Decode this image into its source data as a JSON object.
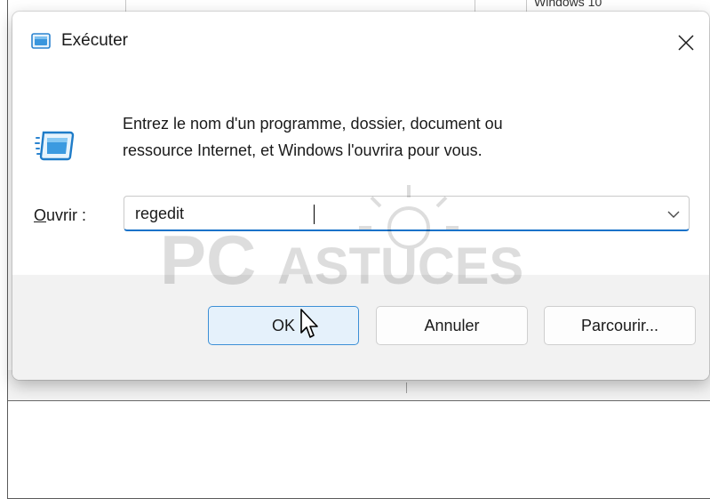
{
  "background": {
    "top_text": "Windows 10"
  },
  "dialog": {
    "title": "Exécuter",
    "title_icon": "run-icon",
    "close_glyph": "✕",
    "prompt_line1": "Entrez le nom d'un programme, dossier, document ou",
    "prompt_line2": "ressource Internet, et Windows l'ouvrira pour vous.",
    "open_label_first": "O",
    "open_label_rest": "uvrir :",
    "open_value": "regedit",
    "buttons": {
      "ok": "OK",
      "cancel": "Annuler",
      "browse": "Parcourir..."
    }
  },
  "watermark": {
    "text_big": "PC",
    "text_small": "ASTUCES"
  },
  "colors": {
    "accent": "#1a73c9",
    "ok_border": "#3d8fd6",
    "ok_fill": "#e5f1fb",
    "footer": "#f2f2f2"
  }
}
